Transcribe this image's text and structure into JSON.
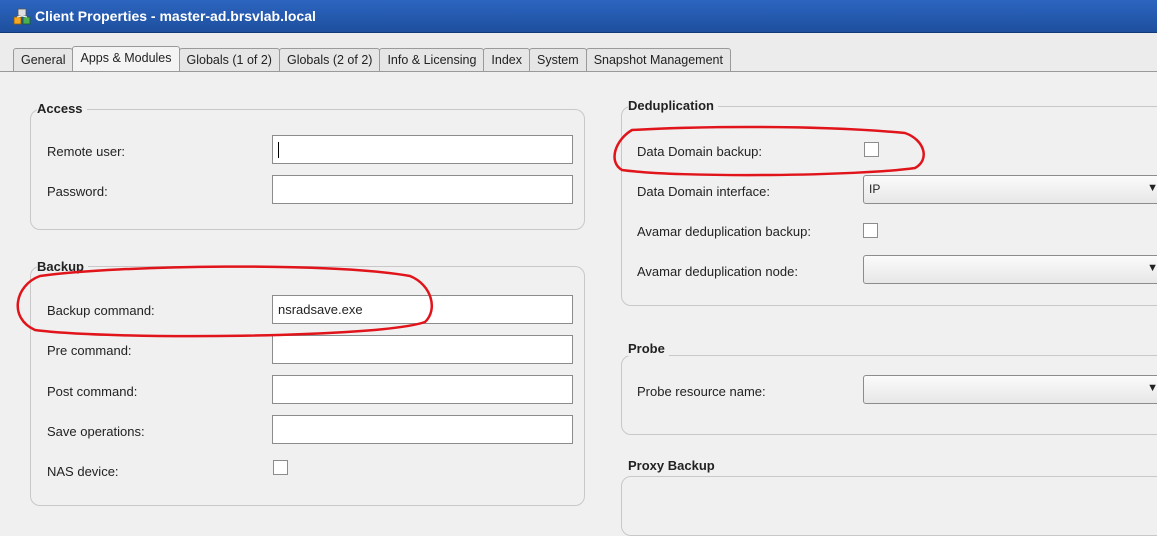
{
  "window": {
    "title": "Client Properties - master-ad.brsvlab.local",
    "icon": "networker-client-icon"
  },
  "tabs": [
    {
      "label": "General",
      "active": false
    },
    {
      "label": "Apps & Modules",
      "active": true
    },
    {
      "label": "Globals (1 of 2)",
      "active": false
    },
    {
      "label": "Globals (2 of 2)",
      "active": false
    },
    {
      "label": "Info & Licensing",
      "active": false
    },
    {
      "label": "Index",
      "active": false
    },
    {
      "label": "System",
      "active": false
    },
    {
      "label": "Snapshot Management",
      "active": false
    }
  ],
  "access": {
    "title": "Access",
    "remote_user_label": "Remote user:",
    "remote_user_value": "",
    "password_label": "Password:",
    "password_value": ""
  },
  "backup": {
    "title": "Backup",
    "backup_command_label": "Backup command:",
    "backup_command_value": "nsradsave.exe",
    "pre_command_label": "Pre command:",
    "pre_command_value": "",
    "post_command_label": "Post command:",
    "post_command_value": "",
    "save_operations_label": "Save operations:",
    "save_operations_value": "",
    "nas_device_label": "NAS device:",
    "nas_device_checked": false
  },
  "deduplication": {
    "title": "Deduplication",
    "dd_backup_label": "Data Domain backup:",
    "dd_backup_checked": false,
    "dd_interface_label": "Data Domain interface:",
    "dd_interface_value": "IP",
    "avamar_backup_label": "Avamar deduplication backup:",
    "avamar_backup_checked": false,
    "avamar_node_label": "Avamar deduplication node:",
    "avamar_node_value": ""
  },
  "probe": {
    "title": "Probe",
    "resource_name_label": "Probe resource name:",
    "resource_name_value": ""
  },
  "proxy_backup": {
    "title": "Proxy Backup"
  },
  "colors": {
    "titlebar": "#1e4f9e",
    "annotation": "#e0141a"
  }
}
